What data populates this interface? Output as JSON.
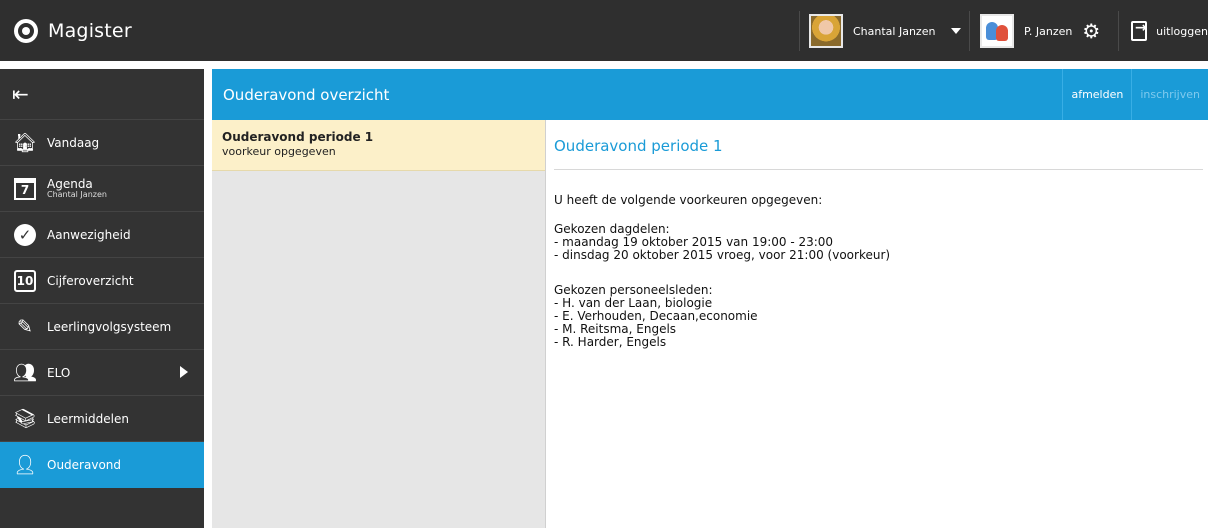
{
  "topbar": {
    "app_name": "Magister",
    "user_name": "Chantal Janzen",
    "parent_name": "P. Janzen",
    "logout_label": "uitloggen"
  },
  "sidebar": {
    "items": [
      {
        "label": "Vandaag",
        "icon": "home-icon"
      },
      {
        "label": "Agenda",
        "sub": "Chantal Janzen",
        "icon": "calendar-icon",
        "icon_text": "7"
      },
      {
        "label": "Aanwezigheid",
        "icon": "check-icon"
      },
      {
        "label": "Cijferoverzicht",
        "icon": "grade-icon",
        "icon_text": "10"
      },
      {
        "label": "Leerlingvolgsysteem",
        "icon": "notebook-icon"
      },
      {
        "label": "ELO",
        "icon": "group-icon"
      },
      {
        "label": "Leermiddelen",
        "icon": "books-icon"
      },
      {
        "label": "Ouderavond",
        "icon": "chat-person-icon",
        "active": true
      }
    ]
  },
  "main": {
    "title": "Ouderavond overzicht",
    "actions": {
      "afmelden": "afmelden",
      "inschrijven": "inschrijven"
    }
  },
  "list": {
    "items": [
      {
        "title": "Ouderavond periode 1",
        "subtitle": "voorkeur opgegeven"
      }
    ]
  },
  "detail": {
    "title": "Ouderavond periode 1",
    "intro": "U heeft de volgende voorkeuren opgegeven:",
    "dagdelen_heading": "Gekozen dagdelen:",
    "dagdelen": [
      "- maandag 19 oktober 2015 van 19:00 - 23:00",
      "- dinsdag 20 oktober 2015 vroeg, voor 21:00 (voorkeur)"
    ],
    "personeel_heading": "Gekozen personeelsleden:",
    "personeel": [
      "- H. van der Laan, biologie",
      "- E. Verhouden, Decaan,economie",
      "- M. Reitsma, Engels",
      "- R. Harder, Engels"
    ]
  },
  "colors": {
    "accent": "#1a9bd7",
    "topbar": "#2f2f2f",
    "sidebar": "#333333",
    "selected_item": "#fcf0c9"
  }
}
